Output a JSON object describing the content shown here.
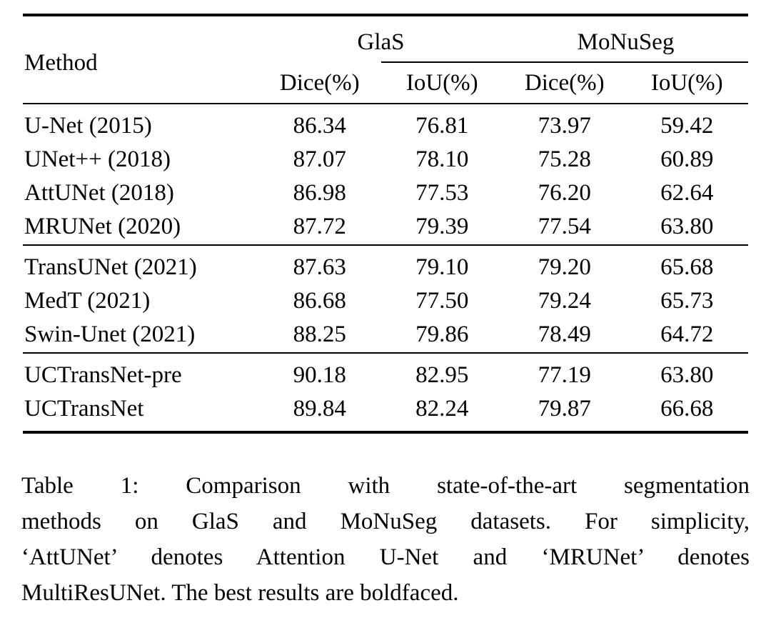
{
  "table": {
    "columns": {
      "method_header": "Method",
      "groups": [
        {
          "label": "GlaS",
          "metrics": [
            "Dice(%)",
            "IoU(%)"
          ]
        },
        {
          "label": "MoNuSeg",
          "metrics": [
            "Dice(%)",
            "IoU(%)"
          ]
        }
      ]
    },
    "group_blocks": [
      {
        "rows": [
          {
            "method": "U-Net (2015)",
            "method_bold": false,
            "values": [
              "86.34",
              "76.81",
              "73.97",
              "59.42"
            ],
            "bold": [
              false,
              false,
              false,
              false
            ]
          },
          {
            "method": "UNet++ (2018)",
            "method_bold": false,
            "values": [
              "87.07",
              "78.10",
              "75.28",
              "60.89"
            ],
            "bold": [
              false,
              false,
              false,
              false
            ]
          },
          {
            "method": "AttUNet (2018)",
            "method_bold": false,
            "values": [
              "86.98",
              "77.53",
              "76.20",
              "62.64"
            ],
            "bold": [
              false,
              false,
              false,
              false
            ]
          },
          {
            "method": "MRUNet (2020)",
            "method_bold": false,
            "values": [
              "87.72",
              "79.39",
              "77.54",
              "63.80"
            ],
            "bold": [
              false,
              false,
              false,
              false
            ]
          }
        ]
      },
      {
        "rows": [
          {
            "method": "TransUNet (2021)",
            "method_bold": false,
            "values": [
              "87.63",
              "79.10",
              "79.20",
              "65.68"
            ],
            "bold": [
              false,
              false,
              false,
              false
            ]
          },
          {
            "method": "MedT (2021)",
            "method_bold": false,
            "values": [
              "86.68",
              "77.50",
              "79.24",
              "65.73"
            ],
            "bold": [
              false,
              false,
              false,
              false
            ]
          },
          {
            "method": "Swin-Unet (2021)",
            "method_bold": false,
            "values": [
              "88.25",
              "79.86",
              "78.49",
              "64.72"
            ],
            "bold": [
              false,
              false,
              false,
              false
            ]
          }
        ]
      },
      {
        "rows": [
          {
            "method": "UCTransNet-pre",
            "method_bold": true,
            "values": [
              "90.18",
              "82.95",
              "77.19",
              "63.80"
            ],
            "bold": [
              true,
              true,
              false,
              false
            ]
          },
          {
            "method": "UCTransNet",
            "method_bold": true,
            "values": [
              "89.84",
              "82.24",
              "79.87",
              "66.68"
            ],
            "bold": [
              false,
              false,
              true,
              true
            ]
          }
        ]
      }
    ]
  },
  "caption": {
    "lines": [
      "Table 1: Comparison with state-of-the-art segmentation",
      "methods on GlaS and MoNuSeg datasets. For simplicity,",
      "‘AttUNet’ denotes Attention U-Net and ‘MRUNet’ denotes",
      "MultiResUNet. The best results are boldfaced."
    ],
    "full_text": "Table 1: Comparison with state-of-the-art segmentation methods on GlaS and MoNuSeg datasets. For simplicity, ‘AttUNet’ denotes Attention U-Net and ‘MRUNet’ denotes MultiResUNet. The best results are boldfaced."
  },
  "colors": {
    "text": "#000000",
    "background": "#ffffff",
    "rule": "#000000"
  }
}
